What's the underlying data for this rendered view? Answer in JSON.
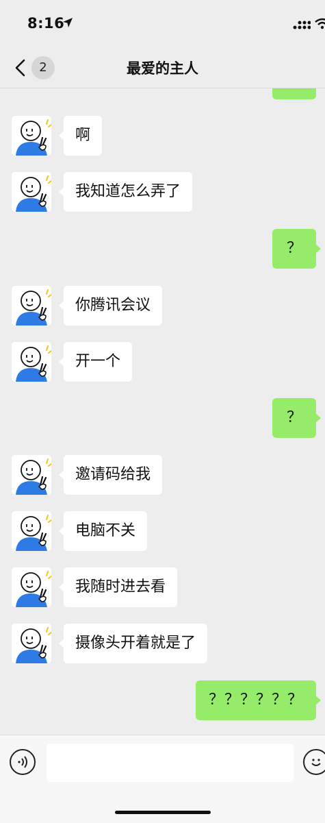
{
  "status_bar": {
    "time": "8:16"
  },
  "nav": {
    "back_badge": "2",
    "title": "最爱的主人"
  },
  "colors": {
    "background": "#ededed",
    "self_bubble": "#95ec69",
    "other_bubble": "#ffffff"
  },
  "messages": [
    {
      "from": "other",
      "text": "啊"
    },
    {
      "from": "other",
      "text": "我知道怎么弄了"
    },
    {
      "from": "self",
      "text": "？"
    },
    {
      "from": "other",
      "text": "你腾讯会议"
    },
    {
      "from": "other",
      "text": "开一个"
    },
    {
      "from": "self",
      "text": "？"
    },
    {
      "from": "other",
      "text": "邀请码给我"
    },
    {
      "from": "other",
      "text": "电脑不关"
    },
    {
      "from": "other",
      "text": "我随时进去看"
    },
    {
      "from": "other",
      "text": "摄像头开着就是了"
    },
    {
      "from": "self",
      "text": "？？？？？？"
    }
  ],
  "input_bar": {
    "value": "",
    "icons": [
      "voice-icon",
      "emoji-icon"
    ]
  }
}
